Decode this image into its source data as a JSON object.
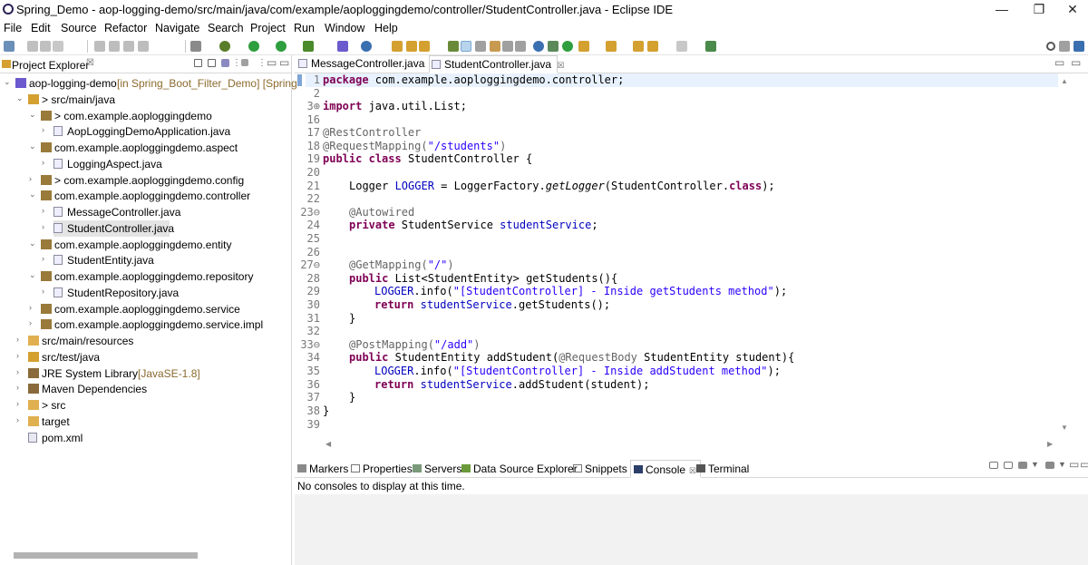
{
  "window": {
    "title": "Spring_Demo - aop-logging-demo/src/main/java/com/example/aoploggingdemo/controller/StudentController.java - Eclipse IDE",
    "minimize": "—",
    "restore": "❐",
    "close": "✕"
  },
  "menu": [
    "File",
    "Edit",
    "Source",
    "Refactor",
    "Navigate",
    "Search",
    "Project",
    "Run",
    "Window",
    "Help"
  ],
  "project_explorer": {
    "title": "Project Explorer",
    "close": "☒",
    "tree": [
      {
        "label": "aop-logging-demo",
        "deco": " [in Spring_Boot_Filter_Demo] [Spring",
        "icon": "project-icon",
        "twisty": "⌄"
      },
      {
        "label": "> src/main/java",
        "icon": "source-folder-icon",
        "twisty": "⌄"
      },
      {
        "label": "> com.example.aoploggingdemo",
        "icon": "package-icon",
        "twisty": "⌄"
      },
      {
        "label": "AopLoggingDemoApplication.java",
        "icon": "java-file-icon",
        "twisty": "›"
      },
      {
        "label": "com.example.aoploggingdemo.aspect",
        "icon": "package-icon",
        "twisty": "⌄"
      },
      {
        "label": "LoggingAspect.java",
        "icon": "java-file-icon",
        "twisty": "›"
      },
      {
        "label": "> com.example.aoploggingdemo.config",
        "icon": "package-icon",
        "twisty": "›"
      },
      {
        "label": "com.example.aoploggingdemo.controller",
        "icon": "package-icon",
        "twisty": "⌄"
      },
      {
        "label": "MessageController.java",
        "icon": "java-file-icon",
        "twisty": "›"
      },
      {
        "label": "StudentController.java",
        "icon": "java-file-icon",
        "twisty": "›"
      },
      {
        "label": "com.example.aoploggingdemo.entity",
        "icon": "package-icon",
        "twisty": "⌄"
      },
      {
        "label": "StudentEntity.java",
        "icon": "java-file-icon",
        "twisty": "›"
      },
      {
        "label": "com.example.aoploggingdemo.repository",
        "icon": "package-icon",
        "twisty": "⌄"
      },
      {
        "label": "StudentRepository.java",
        "icon": "java-file-icon",
        "twisty": "›"
      },
      {
        "label": "com.example.aoploggingdemo.service",
        "icon": "package-icon",
        "twisty": "›"
      },
      {
        "label": "com.example.aoploggingdemo.service.impl",
        "icon": "package-icon",
        "twisty": "›"
      },
      {
        "label": "src/main/resources",
        "icon": "folder-icon",
        "twisty": "›"
      },
      {
        "label": "src/test/java",
        "icon": "source-folder-icon",
        "twisty": "›"
      },
      {
        "label": "JRE System Library",
        "deco": " [JavaSE-1.8]",
        "icon": "library-icon",
        "twisty": "›"
      },
      {
        "label": "Maven Dependencies",
        "icon": "library-icon",
        "twisty": "›"
      },
      {
        "label": "> src",
        "icon": "folder-icon",
        "twisty": "›"
      },
      {
        "label": "target",
        "icon": "folder-icon",
        "twisty": "›"
      },
      {
        "label": "pom.xml",
        "icon": "xml-file-icon",
        "twisty": ""
      }
    ]
  },
  "editor": {
    "tabs": [
      {
        "label": "MessageController.java"
      },
      {
        "label": "StudentController.java",
        "close": "☒"
      }
    ],
    "lines": [
      {
        "n": "1"
      },
      {
        "n": "2"
      },
      {
        "n": "3⊕"
      },
      {
        "n": "16"
      },
      {
        "n": "17"
      },
      {
        "n": "18"
      },
      {
        "n": "19"
      },
      {
        "n": "20"
      },
      {
        "n": "21"
      },
      {
        "n": "22"
      },
      {
        "n": "23⊖"
      },
      {
        "n": "24"
      },
      {
        "n": "25"
      },
      {
        "n": "26"
      },
      {
        "n": "27⊖"
      },
      {
        "n": "28"
      },
      {
        "n": "29"
      },
      {
        "n": "30"
      },
      {
        "n": "31"
      },
      {
        "n": "32"
      },
      {
        "n": "33⊖"
      },
      {
        "n": "34"
      },
      {
        "n": "35"
      },
      {
        "n": "36"
      },
      {
        "n": "37"
      },
      {
        "n": "38"
      },
      {
        "n": "39"
      }
    ],
    "code": {
      "l1_kw": "package",
      "l1_rest": " com.example.aoploggingdemo.controller;",
      "l3_kw": "import",
      "l3_rest": " java.util.List;",
      "l17": "@RestController",
      "l18_a": "@RequestMapping(",
      "l18_s": "\"/students\"",
      "l18_c": ")",
      "l19_kw1": "public",
      "l19_kw2": "class",
      "l19_rest": " StudentController {",
      "l21_a": "Logger ",
      "l21_f": "LOGGER",
      "l21_b": " = LoggerFactory.",
      "l21_i": "getLogger",
      "l21_c": "(StudentController.",
      "l21_kw": "class",
      "l21_d": ");",
      "l23": "@Autowired",
      "l24_kw": "private",
      "l24_a": " StudentService ",
      "l24_f": "studentService",
      "l24_b": ";",
      "l27_a": "@GetMapping(",
      "l27_s": "\"/\"",
      "l27_c": ")",
      "l28_kw": "public",
      "l28_rest": " List<StudentEntity> getStudents(){",
      "l29_f": "LOGGER",
      "l29_a": ".info(",
      "l29_s": "\"[StudentController] - Inside getStudents method\"",
      "l29_b": ");",
      "l30_kw": "return",
      "l30_f": "studentService",
      "l30_rest": ".getStudents();",
      "l31": "}",
      "l33_a": "@PostMapping(",
      "l33_s": "\"/add\"",
      "l33_c": ")",
      "l34_kw": "public",
      "l34_a": " StudentEntity addStudent(",
      "l34_ann": "@RequestBody",
      "l34_b": " StudentEntity student){",
      "l35_f": "LOGGER",
      "l35_a": ".info(",
      "l35_s": "\"[StudentController] - Inside addStudent method\"",
      "l35_b": ");",
      "l36_kw": "return",
      "l36_f": "studentService",
      "l36_rest": ".addStudent(student);",
      "l37": "}",
      "l38": "}"
    }
  },
  "bottom_panel": {
    "tabs": [
      {
        "label": "Markers",
        "icon": "markers-icon"
      },
      {
        "label": "Properties",
        "icon": "properties-icon"
      },
      {
        "label": "Servers",
        "icon": "servers-icon"
      },
      {
        "label": "Data Source Explorer",
        "icon": "data-source-icon"
      },
      {
        "label": "Snippets",
        "icon": "snippets-icon"
      },
      {
        "label": "Console",
        "icon": "console-icon",
        "close": "☒"
      },
      {
        "label": "Terminal",
        "icon": "terminal-icon"
      }
    ],
    "console_message": "No consoles to display at this time."
  },
  "colors": {
    "keyword": "#7f0055",
    "string": "#2a00ff",
    "annotation": "#646464",
    "field": "#0000c0"
  }
}
